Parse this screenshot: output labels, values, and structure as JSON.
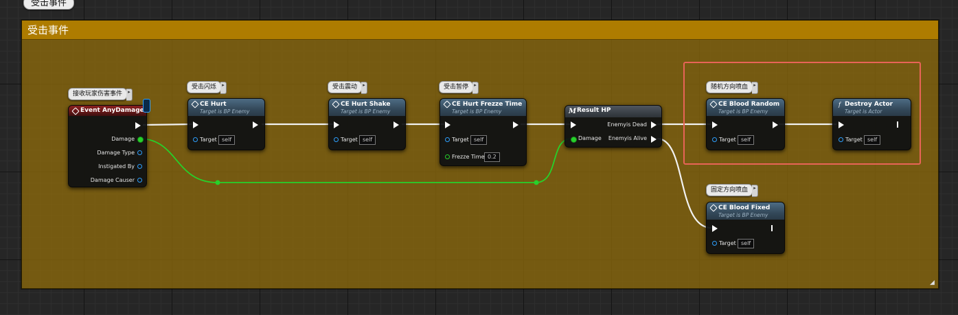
{
  "comment": {
    "bubble": "受击事件",
    "header": "受击事件"
  },
  "nodes": {
    "event": {
      "bubble": "接收玩家伤害事件",
      "title": "Event AnyDamage",
      "pins": [
        "Damage",
        "Damage Type",
        "Instigated By",
        "Damage Causer"
      ]
    },
    "hurt": {
      "bubble": "受击闪烁",
      "title": "CE Hurt",
      "subtitle": "Target is BP Enemy",
      "target_label": "Target",
      "target_value": "self"
    },
    "shake": {
      "bubble": "受击震动",
      "title": "CE Hurt Shake",
      "subtitle": "Target is BP Enemy",
      "target_label": "Target",
      "target_value": "self"
    },
    "freeze": {
      "bubble": "受击暂停",
      "title": "CE Hurt Frezze Time",
      "subtitle": "Target is BP Enemy",
      "target_label": "Target",
      "target_value": "self",
      "time_label": "Frezze Time",
      "time_value": "0.2"
    },
    "result": {
      "icon": "M",
      "title": "Result HP",
      "damage_label": "Damage",
      "out_dead": "Enemyis Dead",
      "out_alive": "Enemyis Alive"
    },
    "blood_random": {
      "bubble": "随机方向喷血",
      "title": "CE Blood Random",
      "subtitle": "Target is BP Enemy",
      "target_label": "Target",
      "target_value": "self"
    },
    "destroy": {
      "icon": "f",
      "title": "Destroy Actor",
      "subtitle": "Target is Actor",
      "target_label": "Target",
      "target_value": "self"
    },
    "blood_fixed": {
      "bubble": "固定方向喷血",
      "title": "CE Blood Fixed",
      "subtitle": "Target is BP Enemy",
      "target_label": "Target",
      "target_value": "self"
    }
  },
  "colors": {
    "comment_fill": "#8c690c",
    "comment_header": "#ae7c00",
    "exec_wire": "#ffffff",
    "float_wire": "#27d12b",
    "object_pin": "#2ea0ff",
    "highlight_box": "#e86458",
    "event_header": "#8a2020",
    "function_header": "#4d6c84"
  },
  "icons": {
    "event_node": "event-diamond-icon",
    "function_node": "function-diamond-icon",
    "macro_node": "macro-m-icon",
    "destroy_node": "function-f-icon",
    "delegate": "delegate-pin-icon"
  }
}
